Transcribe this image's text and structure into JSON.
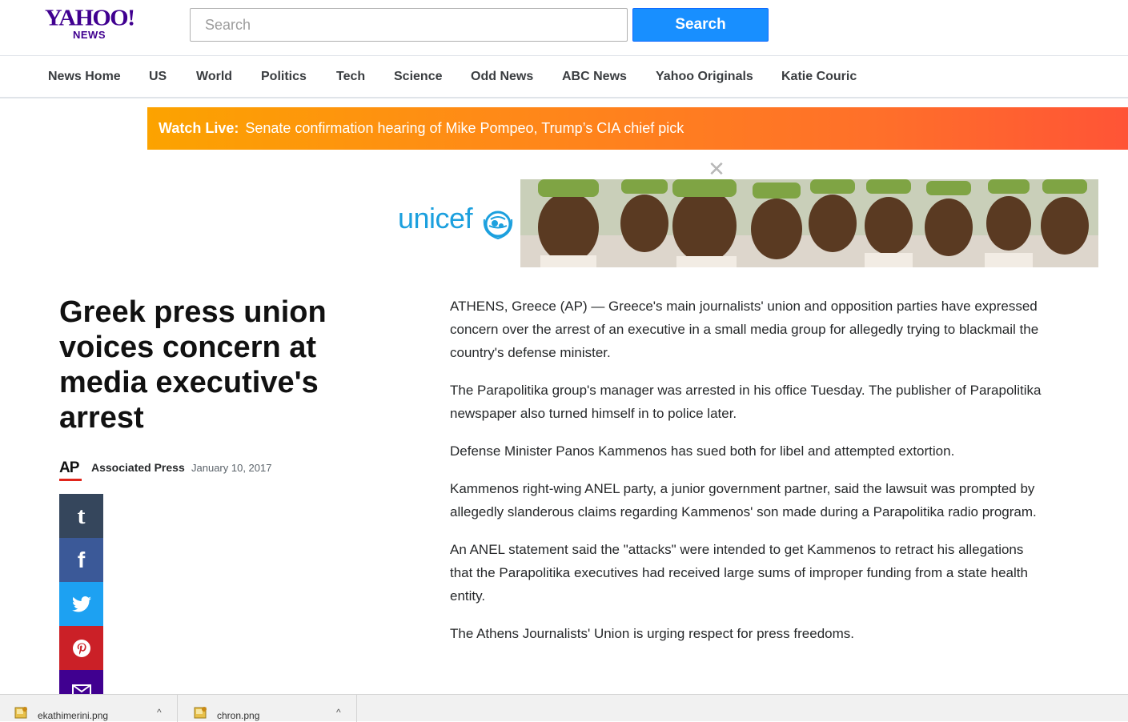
{
  "logo": {
    "wordmark": "YAHOO!",
    "sub": "NEWS"
  },
  "search": {
    "placeholder": "Search",
    "button_label": "Search"
  },
  "nav": [
    "News Home",
    "US",
    "World",
    "Politics",
    "Tech",
    "Science",
    "Odd News",
    "ABC News",
    "Yahoo Originals",
    "Katie Couric"
  ],
  "live_banner": {
    "label": "Watch Live:",
    "text": "Senate confirmation hearing of Mike Pompeo, Trump’s CIA chief pick"
  },
  "ad": {
    "close": "✕",
    "brand": "unicef"
  },
  "article": {
    "title": "Greek press union voices concern at media executive's arrest",
    "source_logo": "AP",
    "provider": "Associated Press",
    "date": "January 10, 2017",
    "paragraphs": [
      "ATHENS, Greece (AP) — Greece's main journalists' union and opposition parties have expressed concern over the arrest of an executive in a small media group for allegedly trying to blackmail the country's defense minister.",
      "The Parapolitika group's manager was arrested in his office Tuesday. The publisher of Parapolitika newspaper also turned himself in to police later.",
      "Defense Minister Panos Kammenos has sued both for libel and attempted extortion.",
      "Kammenos right-wing ANEL party, a junior government partner, said the lawsuit was prompted by allegedly slanderous claims regarding Kammenos' son made during a Parapolitika radio program.",
      "An ANEL statement said the \"attacks\" were intended to get Kammenos to retract his allegations that the Parapolitika executives had received large sums of improper funding from a state health entity.",
      "The Athens Journalists' Union is urging respect for press freedoms."
    ]
  },
  "share": [
    {
      "name": "tumblr",
      "glyph": "t",
      "color": "#35465c"
    },
    {
      "name": "facebook",
      "glyph": "f",
      "color": "#3b5998"
    },
    {
      "name": "twitter",
      "glyph": "",
      "color": "#1da1f2"
    },
    {
      "name": "pinterest",
      "glyph": "",
      "color": "#cb2027"
    },
    {
      "name": "email",
      "glyph": "",
      "color": "#400090"
    }
  ],
  "downloads": [
    {
      "name": "ekathimerini.png",
      "caret": "^"
    },
    {
      "name": "chron.png",
      "caret": "^"
    }
  ],
  "colors": {
    "yahoo_purple": "#400090",
    "search_blue": "#188fff",
    "live_orange": "#ff8a17"
  }
}
